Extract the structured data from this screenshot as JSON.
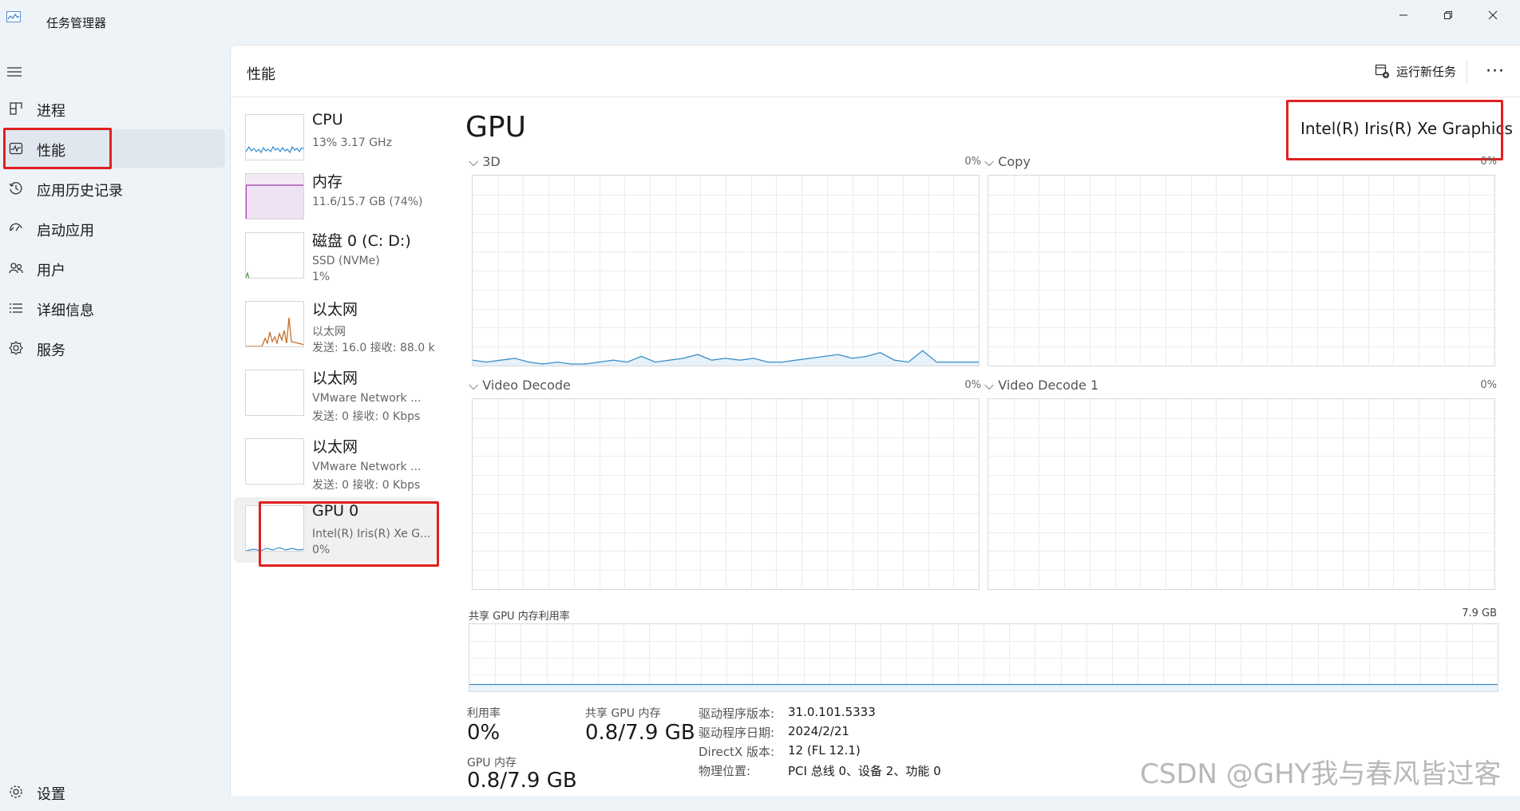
{
  "window": {
    "title": "任务管理器"
  },
  "sidebar": {
    "items": [
      {
        "label": "进程",
        "icon": "grid-icon"
      },
      {
        "label": "性能",
        "icon": "performance-icon"
      },
      {
        "label": "应用历史记录",
        "icon": "history-icon"
      },
      {
        "label": "启动应用",
        "icon": "startup-icon"
      },
      {
        "label": "用户",
        "icon": "users-icon"
      },
      {
        "label": "详细信息",
        "icon": "list-icon"
      },
      {
        "label": "服务",
        "icon": "gear-icon"
      }
    ],
    "settings_label": "设置",
    "active_index": 1
  },
  "header": {
    "title": "性能",
    "run_task_label": "运行新任务",
    "more_label": "···"
  },
  "devices": [
    {
      "name": "CPU",
      "line1": "13% 3.17 GHz",
      "line2": ""
    },
    {
      "name": "内存",
      "line1": "11.6/15.7 GB (74%)",
      "line2": ""
    },
    {
      "name": "磁盘 0 (C: D:)",
      "line1": "SSD (NVMe)",
      "line2": "1%"
    },
    {
      "name": "以太网",
      "line1": "以太网",
      "line2": "发送: 16.0 接收: 88.0 k"
    },
    {
      "name": "以太网",
      "line1": "VMware Network ...",
      "line2": "发送: 0 接收: 0 Kbps"
    },
    {
      "name": "以太网",
      "line1": "VMware Network ...",
      "line2": "发送: 0 接收: 0 Kbps"
    },
    {
      "name": "GPU 0",
      "line1": "Intel(R) Iris(R) Xe G...",
      "line2": "0%"
    }
  ],
  "gpu": {
    "title": "GPU",
    "model": "Intel(R) Iris(R) Xe Graphics",
    "engines": [
      {
        "label": "3D",
        "percent": "0%",
        "usage": [
          2,
          1,
          2,
          3,
          1,
          0,
          1,
          0,
          0,
          1,
          2,
          1,
          4,
          1,
          2,
          3,
          5,
          2,
          3,
          2,
          3,
          1,
          1,
          2,
          3,
          4,
          5,
          3,
          4,
          6,
          2,
          1,
          7,
          1,
          1,
          1,
          1
        ],
        "usage_unit": "percent"
      },
      {
        "label": "Copy",
        "percent": "0%",
        "usage": []
      },
      {
        "label": "Video Decode",
        "percent": "0%",
        "usage": []
      },
      {
        "label": "Video Decode 1",
        "percent": "0%",
        "usage": []
      }
    ],
    "shared_memory_label": "共享 GPU 内存利用率",
    "shared_memory_max": "7.9 GB",
    "stats": {
      "utilization_label": "利用率",
      "utilization_value": "0%",
      "shared_mem_label": "共享 GPU 内存",
      "shared_mem_value": "0.8/7.9 GB",
      "gpu_mem_label": "GPU 内存",
      "gpu_mem_value": "0.8/7.9 GB"
    },
    "properties": [
      {
        "key": "驱动程序版本:",
        "value": "31.0.101.5333"
      },
      {
        "key": "驱动程序日期:",
        "value": "2024/2/21"
      },
      {
        "key": "DirectX 版本:",
        "value": "12 (FL 12.1)"
      },
      {
        "key": "物理位置:",
        "value": "PCI 总线 0、设备 2、功能 0"
      }
    ]
  },
  "watermark": "CSDN @GHY我与春风皆过客",
  "colors": {
    "gpu_line": "#3a8ec8",
    "cpu_line": "#2f8fd0",
    "mem_line": "#9b39a8",
    "eth_line": "#c7702a",
    "highlight": "#e02020"
  }
}
